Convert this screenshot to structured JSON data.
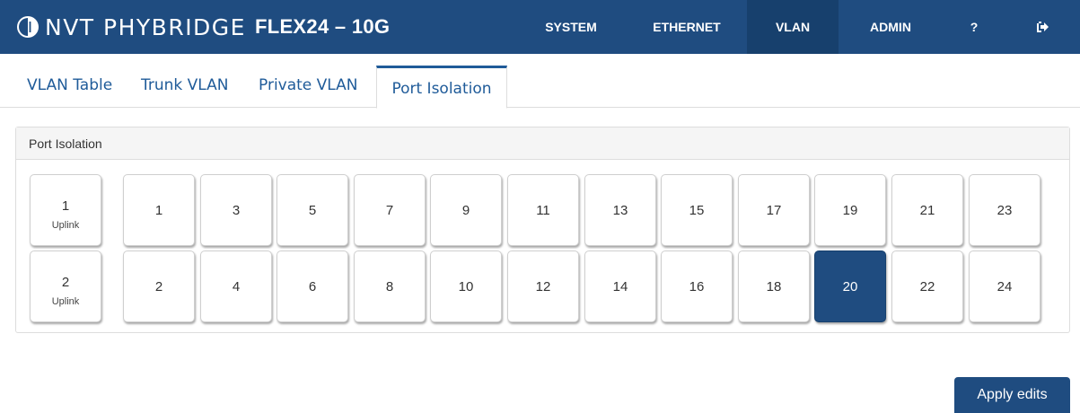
{
  "brand": {
    "name": "NVT PHYBRIDGE",
    "model": "FLEX24 – 10G",
    "logo_icon": "nvt-phybridge-logo-icon"
  },
  "nav": {
    "system": "SYSTEM",
    "ethernet": "ETHERNET",
    "vlan": "VLAN",
    "admin": "ADMIN",
    "help": "?",
    "logout_icon": "sign-out-icon",
    "active": "VLAN"
  },
  "tabs": {
    "vlan_table": "VLAN Table",
    "trunk_vlan": "Trunk VLAN",
    "private_vlan": "Private VLAN",
    "port_isolation": "Port Isolation",
    "active": "Port Isolation"
  },
  "panel": {
    "title": "Port Isolation",
    "uplinks": [
      {
        "number": "1",
        "label": "Uplink"
      },
      {
        "number": "2",
        "label": "Uplink"
      }
    ],
    "ports_top": [
      "1",
      "3",
      "5",
      "7",
      "9",
      "11",
      "13",
      "15",
      "17",
      "19",
      "21",
      "23"
    ],
    "ports_bottom": [
      "2",
      "4",
      "6",
      "8",
      "10",
      "12",
      "14",
      "16",
      "18",
      "20",
      "22",
      "24"
    ],
    "selected_port": "20"
  },
  "apply_label": "Apply edits",
  "colors": {
    "primary": "#1f4c80",
    "link": "#1f5b99",
    "active_nav": "#17406d"
  }
}
